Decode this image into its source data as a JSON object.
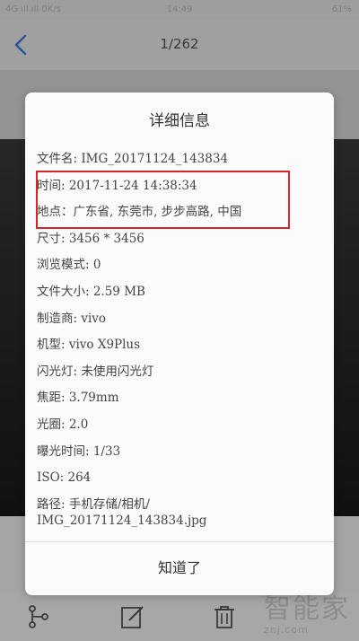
{
  "status_bar": {
    "left": "4G ıll ıll 0K/s",
    "time": "14:49",
    "right": "61%"
  },
  "nav": {
    "counter": "1/262"
  },
  "dialog": {
    "title": "详细信息",
    "rows": [
      "文件名: IMG_20171124_143834",
      "时间: 2017-11-24 14:38:34",
      "地点：广东省, 东莞市, 步步高路, 中国",
      "尺寸: 3456 * 3456",
      "浏览模式: 0",
      "文件大小: 2.59 MB",
      "制造商: vivo",
      "机型: vivo X9Plus",
      "闪光灯: 未使用闪光灯",
      "焦距: 3.79mm",
      "光圈: 2.0",
      "曝光时间: 1/33",
      "ISO: 264"
    ],
    "path_line1": "路径: 手机存储/相机/",
    "path_line2": "IMG_20171124_143834.jpg",
    "ok_label": "知道了"
  },
  "watermark": {
    "brand": "智能家",
    "domain": "znj.com"
  },
  "colors": {
    "highlight_border": "#d9232b",
    "back_arrow": "#3d7be0"
  },
  "icons": [
    "back-arrow-icon",
    "share-icon",
    "edit-icon",
    "delete-icon"
  ]
}
